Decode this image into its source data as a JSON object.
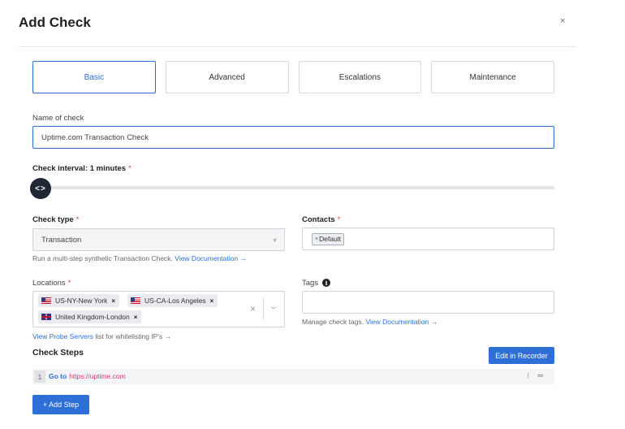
{
  "dialog": {
    "title": "Add Check",
    "close_label": "×"
  },
  "tabs": [
    {
      "label": "Basic",
      "active": true
    },
    {
      "label": "Advanced",
      "active": false
    },
    {
      "label": "Escalations",
      "active": false
    },
    {
      "label": "Maintenance",
      "active": false
    }
  ],
  "name_field": {
    "label": "Name of check",
    "value": "Uptime.com Transaction Check"
  },
  "interval": {
    "label": "Check interval: 1 minutes",
    "required_mark": "*",
    "knob_glyph": "<>",
    "value_minutes": 1
  },
  "check_type": {
    "label": "Check type",
    "required_mark": "*",
    "value": "Transaction",
    "arrow": "▼",
    "helper": "Run a multi-step synthetic Transaction Check.",
    "helper_link": "View Documentation →"
  },
  "contacts": {
    "label": "Contacts",
    "required_mark": "*",
    "chip_x": "×",
    "chip": "Default"
  },
  "locations": {
    "label": "Locations",
    "required_mark": "*",
    "chips": [
      {
        "label": "US-NY-New York",
        "flag": "us",
        "remove": "×"
      },
      {
        "label": "US-CA-Los Angeles",
        "flag": "us",
        "remove": "×"
      },
      {
        "label": "United Kingdom-London",
        "flag": "uk",
        "remove": "×"
      }
    ],
    "clear_icon": "×",
    "chevron_icon": "⌄",
    "helper_link": "View Probe Servers",
    "helper": "list for whitelisting IP's →"
  },
  "tags": {
    "label": "Tags",
    "info_icon": "i",
    "helper": "Manage check tags.",
    "helper_link": "View Documentation →"
  },
  "check_steps": {
    "title": "Check Steps",
    "edit_button": "Edit in Recorder",
    "steps": [
      {
        "number": "1",
        "command": "Go to",
        "target": "https://uptime.com"
      }
    ],
    "row_tools": "⁝ ═",
    "add_button": "+ Add Step"
  },
  "colors": {
    "accent": "#2d6fd6",
    "required": "#e0443c",
    "knob": "#1f2733",
    "url": "#d1397a"
  }
}
